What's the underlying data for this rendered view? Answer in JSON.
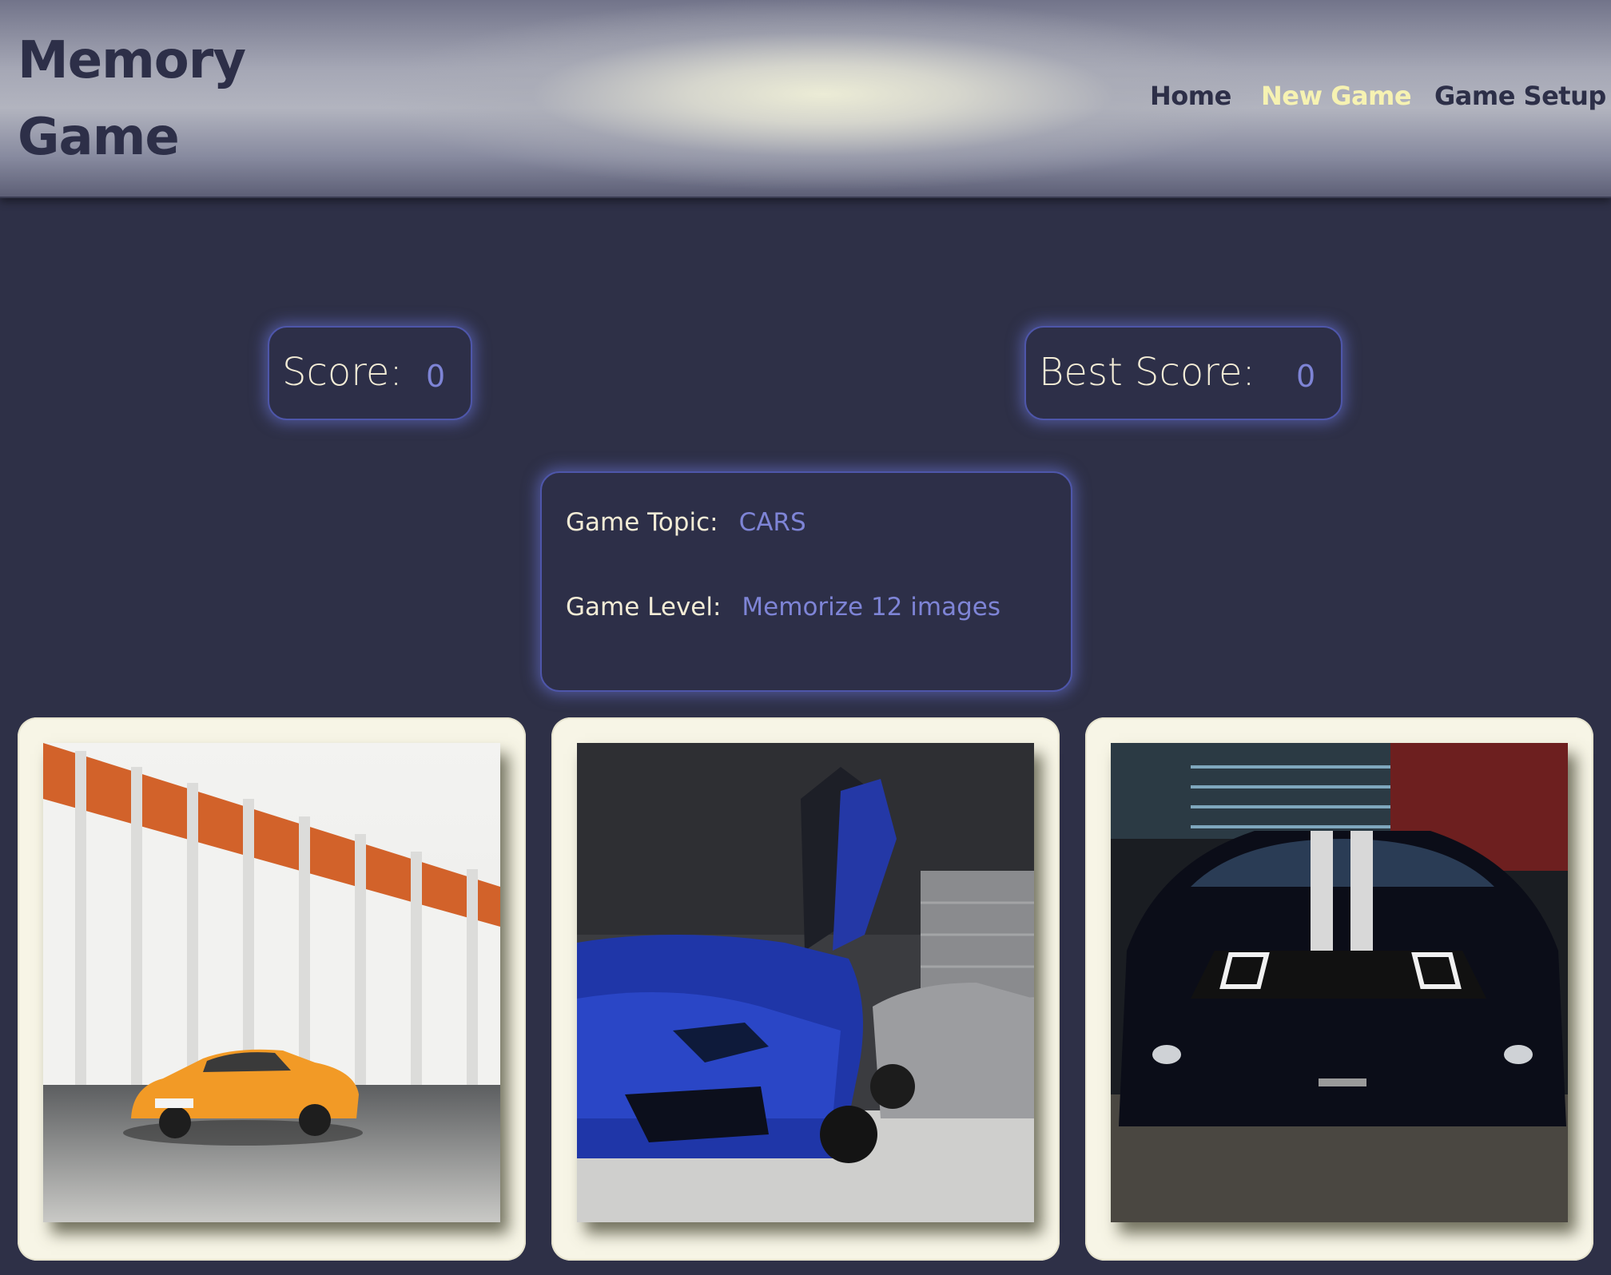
{
  "header": {
    "logo_line1": "Memory",
    "logo_line2": "Game",
    "nav": [
      {
        "label": "Home",
        "active": false
      },
      {
        "label": "New Game",
        "active": true
      },
      {
        "label": "Game Setup",
        "active": false
      }
    ]
  },
  "scores": {
    "score_label": "Score:",
    "score_value": "0",
    "best_label": "Best Score:",
    "best_value": "0"
  },
  "info": {
    "topic_label": "Game Topic:",
    "topic_value": "CARS",
    "level_label": "Game Level:",
    "level_value": "Memorize 12 images"
  },
  "cards": [
    {
      "image": "orange-sports-car-photo"
    },
    {
      "image": "blue-supercar-photo"
    },
    {
      "image": "black-muscle-car-photo"
    }
  ],
  "colors": {
    "background": "#2e3047",
    "accent": "#7e84d6",
    "active_nav": "#f6f2b2",
    "card": "#f7f5e6"
  }
}
